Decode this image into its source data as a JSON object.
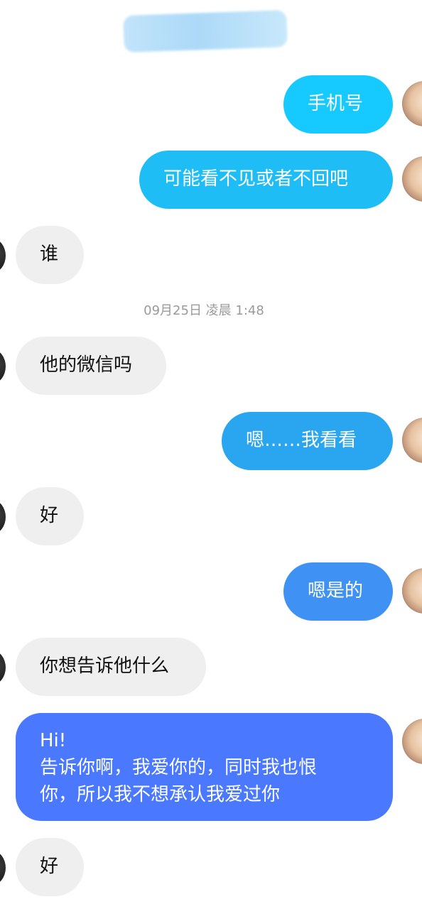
{
  "conversation": {
    "timestamp": "09月25日 凌晨 1:48",
    "messages": [
      {
        "side": "out",
        "text": "手机号"
      },
      {
        "side": "out",
        "text": "可能看不见或者不回吧"
      },
      {
        "side": "in",
        "text": "谁"
      },
      {
        "side": "in",
        "text": "他的微信吗"
      },
      {
        "side": "out",
        "text": "嗯……我看看"
      },
      {
        "side": "in",
        "text": "好"
      },
      {
        "side": "out",
        "text": "嗯是的"
      },
      {
        "side": "in",
        "text": "你想告诉他什么"
      },
      {
        "side": "out",
        "lines": [
          "Hi!",
          "告诉你啊，我爱你的，同时我也恨",
          "你，所以我不想承认我爱过你"
        ]
      },
      {
        "side": "in",
        "text": "好"
      }
    ]
  },
  "theme": {
    "incoming_bubble": "#efefef",
    "outgoing_bubble_colors": [
      "#16c9ff",
      "#1fbdf6",
      "#2aa5ef",
      "#3f92f3",
      "#4a79ff"
    ],
    "text_dark": "#111111",
    "timestamp_color": "#9a9a9a"
  }
}
